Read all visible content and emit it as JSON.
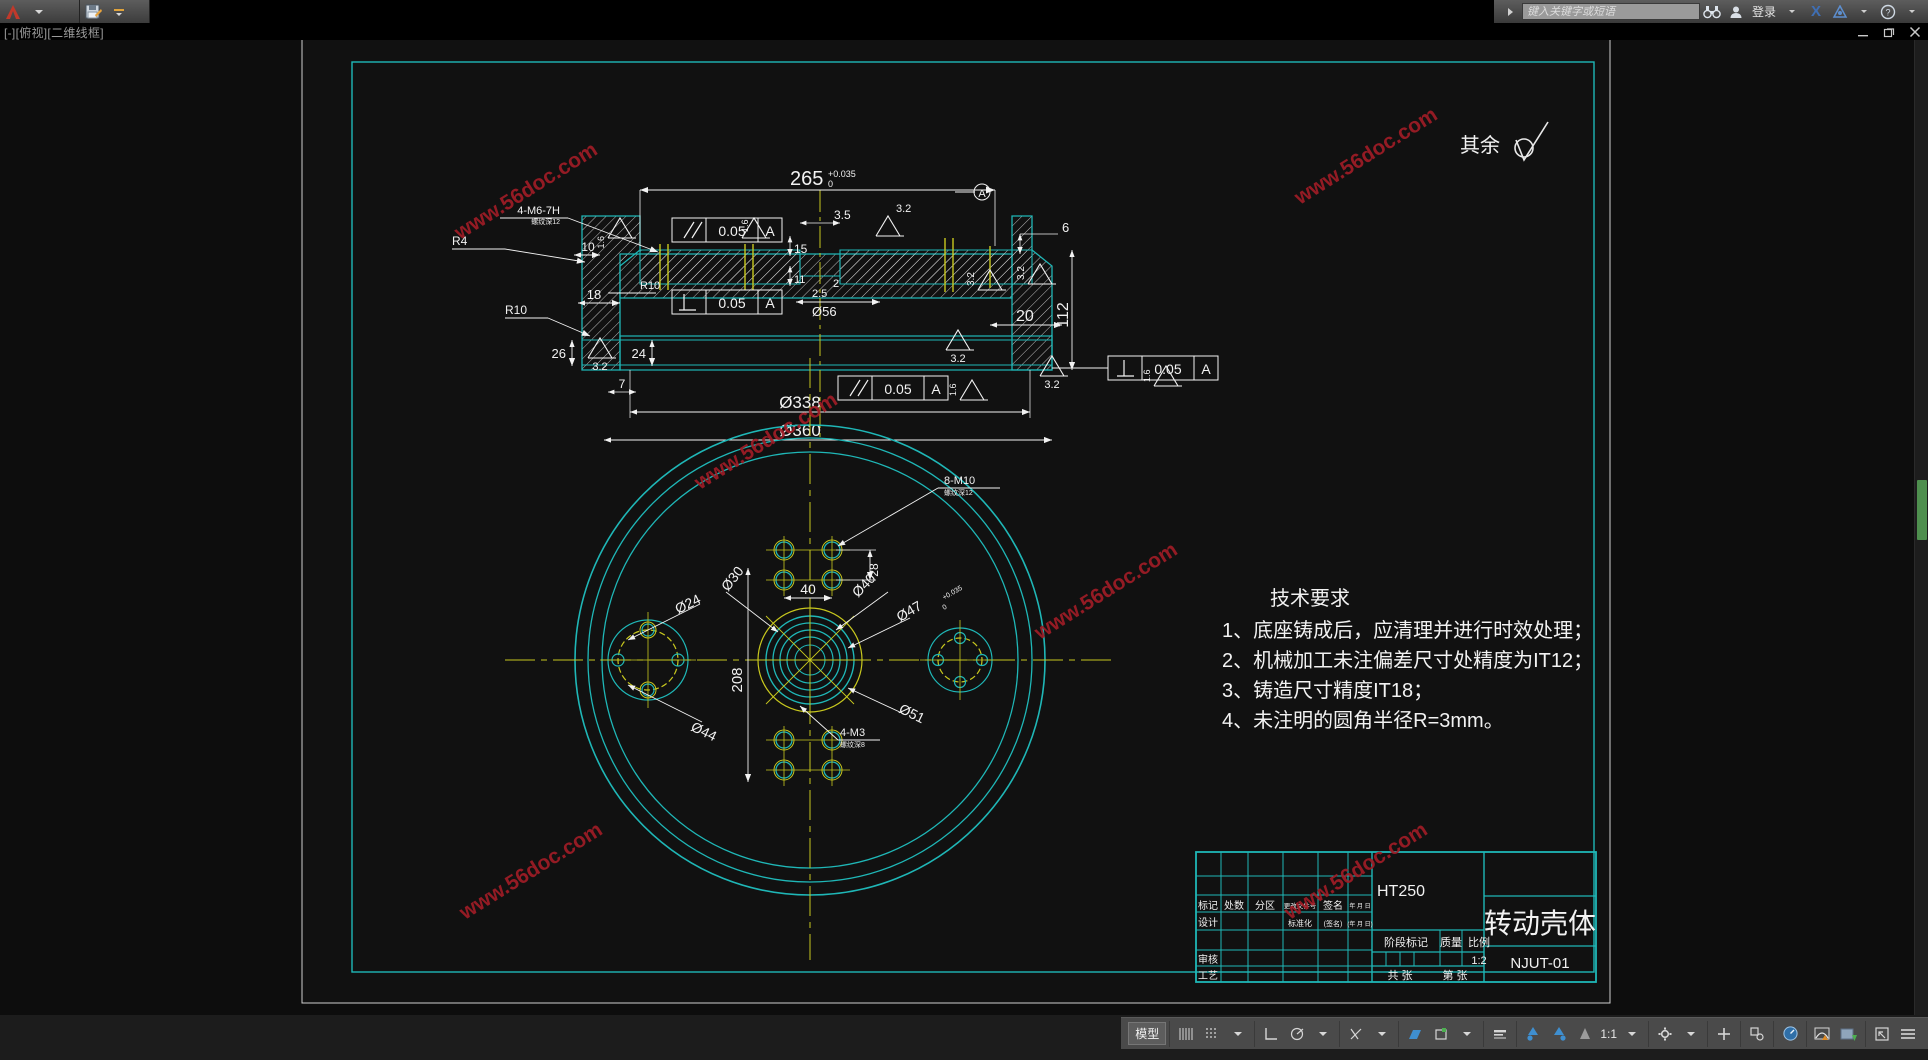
{
  "app": {
    "viewport_label": "[-][俯视][二维线框]",
    "search_placeholder": "键入关键字或短语",
    "signin_label": "登录"
  },
  "titlebar": {
    "app_menu_icon": "autocad-logo-icon",
    "qat_icons": [
      "save-as-icon",
      "menu-caret-icon"
    ],
    "infocenter_icons": [
      "search-binoculars-icon",
      "user-icon",
      "exchange-x-icon",
      "autodesk-360-icon",
      "help-icon"
    ],
    "window_buttons": [
      "minimize",
      "restore",
      "close"
    ]
  },
  "statusbar": {
    "model_label": "模型",
    "scale_label": "1:1",
    "icons": [
      "grid-display-icon",
      "snap-mode-icon",
      "ortho-mode-icon",
      "polar-tracking-icon",
      "object-snap-icon",
      "osnap-tracking-icon",
      "dynamic-ucs-icon",
      "dynamic-input-icon",
      "lineweight-icon",
      "transparency-icon",
      "selection-cycling-icon",
      "annotation-visibility-icon",
      "autoscale-icon",
      "annotation-scale-icon",
      "workspace-gear-icon",
      "hardware-accel-icon",
      "isolate-objects-icon",
      "cleanscreen-icon",
      "customization-menu-icon"
    ]
  },
  "drawing": {
    "general_surface_note": "其余",
    "tech_title": "技术要求",
    "tech_notes": [
      "1、底座铸成后，应清理并进行时效处理；",
      "2、机械加工未注偏差尺寸处精度为IT12；",
      "3、铸造尺寸精度IT18；",
      "4、未注明的圆角半径R=3mm。"
    ],
    "section_view": {
      "dims": {
        "top_overall": "265",
        "top_tol": "+0.035",
        "top_tol_low": "0",
        "d1": "10",
        "d2": "18",
        "d3": "26",
        "d4": "24",
        "d5": "15",
        "d6": "11",
        "d7": "2.5",
        "d8": "2",
        "d9": "3.5",
        "d10": "6",
        "d11": "20",
        "d12": "112",
        "d13": "7",
        "bore": "Ø56",
        "outer_dia": "Ø338",
        "outer_dia2": "Ø360"
      },
      "callouts": {
        "thread_top": "4-M6-7H",
        "thread_top_depth": "螺纹深12",
        "r4": "R4",
        "r10a": "R10",
        "r10b": "R10"
      },
      "roughness": [
        "1.6",
        "1.6",
        "3.2",
        "3.2",
        "3.2",
        "3.2",
        "3.2",
        "3.2"
      ],
      "gdt": [
        {
          "symbol": "//",
          "tol": "0.05",
          "datum": "A"
        },
        {
          "symbol": "//",
          "tol": "0.05",
          "datum": "A"
        },
        {
          "symbol": "//",
          "tol": "0.05",
          "datum": "A"
        },
        {
          "symbol": "⊥",
          "tol": "0.05",
          "datum": "A"
        },
        {
          "symbol": "⊥",
          "tol": "0.05",
          "datum": "A"
        }
      ],
      "datum_label": "A"
    },
    "plan_view": {
      "callouts": {
        "bolt_thread": "8-M10",
        "bolt_thread_depth": "螺纹深12",
        "small_thread": "4-M3",
        "small_thread_depth": "螺纹深8"
      },
      "dims": {
        "p28": "28",
        "p40": "40",
        "p208": "208",
        "d24": "Ø24",
        "d44": "Ø44",
        "d30": "Ø30",
        "d40": "Ø40",
        "d47": "Ø47",
        "d47_tol_up": "+0.035",
        "d47_tol_low": "0",
        "d51": "Ø51"
      }
    },
    "title_block": {
      "part_name": "转动壳体",
      "drawing_number": "NJUT-01",
      "material": "HT250",
      "scale_value": "1:2",
      "headers": {
        "mark": "标记",
        "count": "处数",
        "zone": "分区",
        "change_file": "更改文件号",
        "signature": "签名",
        "date": "年 月 日",
        "design": "设计",
        "standardize": "标准化",
        "sign2": "(签名)",
        "date2": "(年 月 日)",
        "review": "审核",
        "process": "工艺",
        "stage_mark": "阶段标记",
        "weight": "质量",
        "ratio": "比例",
        "total_sheets": "共    张",
        "sheet_no": "第    张"
      }
    },
    "watermarks": [
      "www.56doc.com",
      "www.56doc.com",
      "www.56doc.com",
      "www.56doc.com",
      "www.56doc.com",
      "www.56doc.com"
    ]
  },
  "colors": {
    "cad_background": "#0d0d0d",
    "geometry_cyan": "#1fb7b7",
    "annotation_white": "#f2f2f2",
    "centerline_yellow": "#c8c81e",
    "watermark_red": "#a01c26",
    "frame_cyan": "#1fb7b7"
  }
}
